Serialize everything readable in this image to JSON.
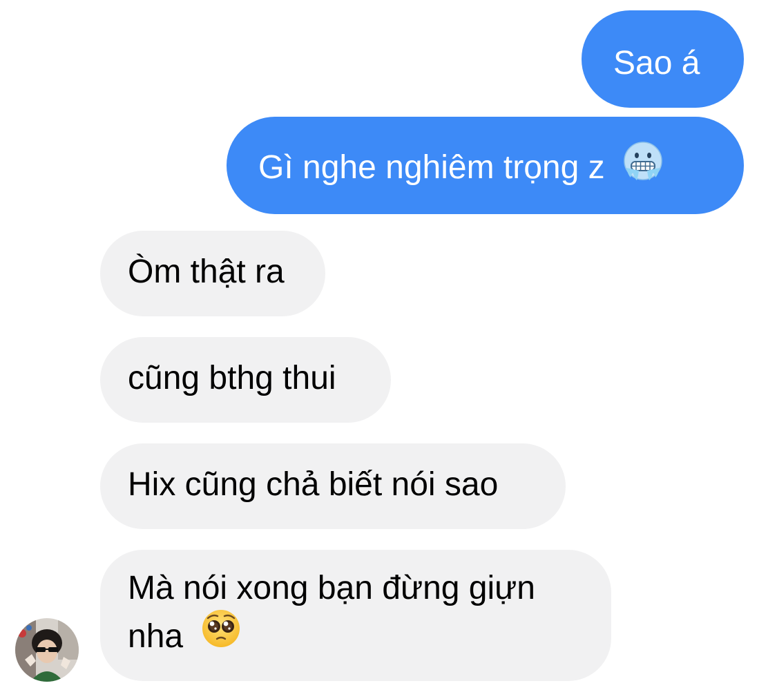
{
  "conversation": {
    "messages": [
      {
        "from": "me",
        "text": "Sao á"
      },
      {
        "from": "me",
        "text": "Gì nghe nghiêm trọng z",
        "emoji": "cold-face-emoji"
      },
      {
        "from": "them",
        "text": "Òm thật ra"
      },
      {
        "from": "them",
        "text": "cũng bthg thui"
      },
      {
        "from": "them",
        "text": "Hix cũng chả biết nói sao"
      },
      {
        "from": "them",
        "text_line1": "Mà nói xong bạn đừng giựn",
        "text_line2": "nha",
        "emoji": "pleading-face-emoji"
      }
    ],
    "contact": {
      "avatar": "contact-avatar"
    }
  },
  "colors": {
    "outgoing_bubble": "#3d8af7",
    "incoming_bubble": "#f1f1f2",
    "outgoing_text": "#ffffff",
    "incoming_text": "#000000"
  }
}
